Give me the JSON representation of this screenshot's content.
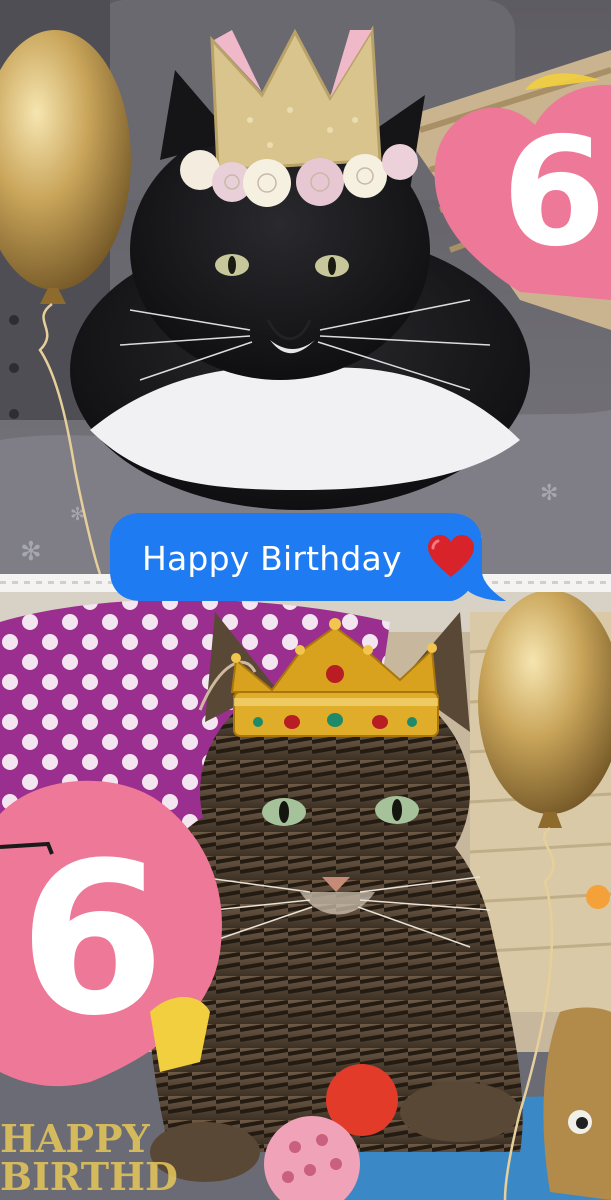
{
  "message": {
    "text": "Happy Birthday",
    "emoji": "red-heart-icon",
    "bubble_color": "#1f7bf2"
  },
  "stickers": {
    "top_number": "6",
    "bottom_number": "6",
    "heart_color": "#ee7898"
  },
  "mat_text": {
    "line1": "HAPPY",
    "line2": "BIRTHD"
  },
  "colors": {
    "balloon_gold": "#c9a55a",
    "crown_gold": "#d9a21e",
    "glitter_crown": "#d8c48c",
    "polka_purple": "#9a2f8f"
  }
}
